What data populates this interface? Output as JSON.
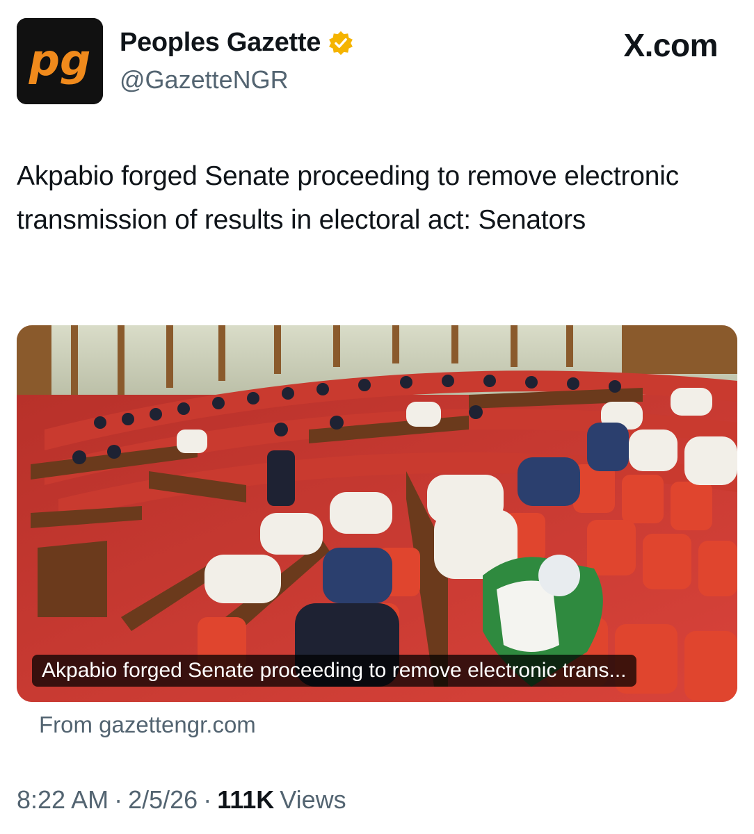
{
  "account": {
    "display_name": "Peoples Gazette",
    "handle": "@GazetteNGR",
    "avatar_logo_text": "pg",
    "verified": true,
    "verified_color": "#f5b400"
  },
  "brand": {
    "label": "X.com"
  },
  "tweet": {
    "text": "Akpabio forged Senate proceeding to remove electronic transmission of results in electoral act: Senators"
  },
  "link_card": {
    "caption": "Akpabio forged Senate proceeding to remove electronic trans...",
    "source": "From gazettengr.com",
    "image_subject": "senate-chamber-photo"
  },
  "meta": {
    "time": "8:22 AM",
    "separator": "·",
    "date": "2/5/26",
    "views_count": "111K",
    "views_label": "Views"
  },
  "colors": {
    "text": "#0f1419",
    "secondary": "#536471",
    "logo_orange": "#f08a1c",
    "avatar_bg": "#111111"
  }
}
